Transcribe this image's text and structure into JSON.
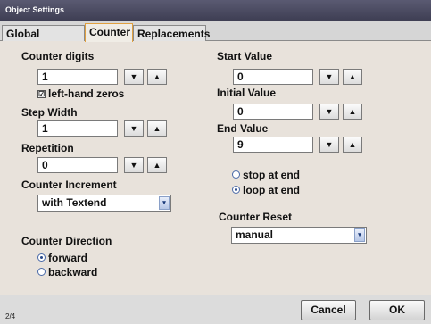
{
  "window": {
    "title": "Object Settings"
  },
  "tabs": [
    {
      "label": "Global Settings"
    },
    {
      "label": "Counter"
    },
    {
      "label": "Replacements"
    }
  ],
  "left": {
    "counter_digits": {
      "label": "Counter digits",
      "value": "1"
    },
    "left_hand_zeros": {
      "label": "left-hand zeros",
      "checked": true,
      "mark": "☑"
    },
    "step_width": {
      "label": "Step Width",
      "value": "1"
    },
    "repetition": {
      "label": "Repetition",
      "value": "0"
    },
    "counter_increment": {
      "label": "Counter Increment",
      "value": "with Textend"
    },
    "counter_direction": {
      "label": "Counter Direction",
      "options": [
        {
          "label": "forward",
          "selected": true
        },
        {
          "label": "backward",
          "selected": false
        }
      ]
    }
  },
  "right": {
    "start_value": {
      "label": "Start Value",
      "value": "0"
    },
    "initial_value": {
      "label": "Initial Value",
      "value": "0"
    },
    "end_value": {
      "label": "End Value",
      "value": "9"
    },
    "end_behavior": {
      "options": [
        {
          "label": "stop at end",
          "selected": false
        },
        {
          "label": "loop at end",
          "selected": true
        }
      ]
    },
    "counter_reset": {
      "label": "Counter Reset",
      "value": "manual"
    }
  },
  "spinner": {
    "down": "▼",
    "up": "▲"
  },
  "select_arrow": "▾",
  "footer": {
    "page": "2/4",
    "cancel_label": "Cancel",
    "ok_label": "OK"
  },
  "colors": {
    "panel_bg": "#e8e2db",
    "active_tab_border": "#e0a040",
    "titlebar": "#4a4a60"
  }
}
